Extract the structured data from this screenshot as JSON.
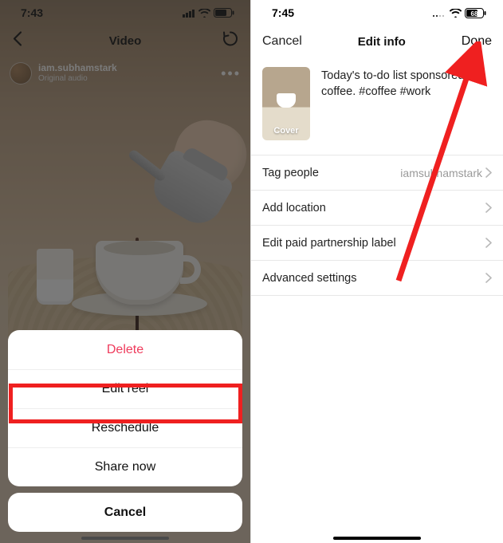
{
  "left": {
    "status": {
      "time": "7:43",
      "battery": "70"
    },
    "nav": {
      "title": "Video"
    },
    "header": {
      "username": "iam.subhamstark",
      "audio_label": "Original audio"
    },
    "sheet": {
      "delete": "Delete",
      "edit_reel": "Edit reel",
      "reschedule": "Reschedule",
      "share_now": "Share now",
      "cancel": "Cancel"
    }
  },
  "right": {
    "status": {
      "time": "7:45",
      "battery": "68"
    },
    "nav": {
      "cancel": "Cancel",
      "title": "Edit info",
      "done": "Done"
    },
    "cover_label": "Cover",
    "caption": "Today's to-do list sponsored by coffee. #coffee #work",
    "rows": {
      "tag_people": {
        "label": "Tag people",
        "value": "iamsubhamstark"
      },
      "add_location": {
        "label": "Add location"
      },
      "paid_partnership": {
        "label": "Edit paid partnership label"
      },
      "advanced": {
        "label": "Advanced settings"
      }
    }
  }
}
